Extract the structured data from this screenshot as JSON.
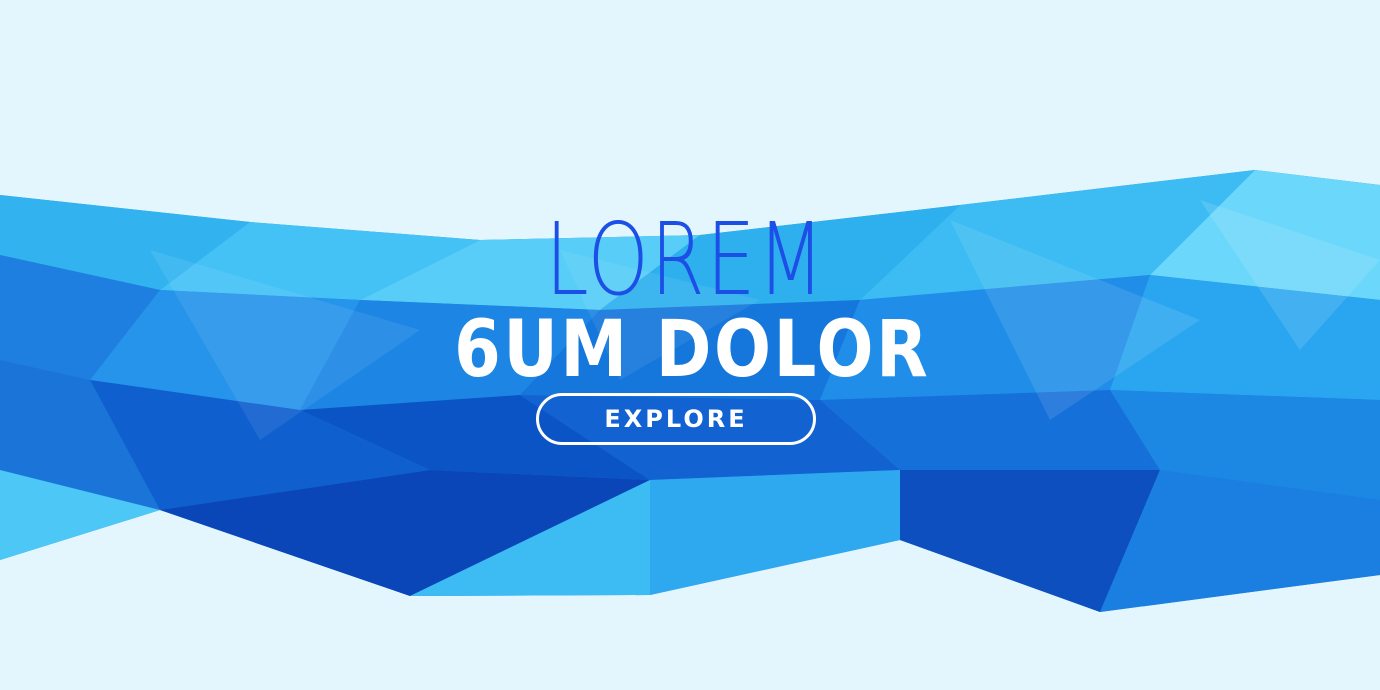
{
  "banner": {
    "headline_top": "LOREM",
    "headline_bottom": "6UM DOLOR",
    "button_label": "EXPLORE"
  },
  "colors": {
    "background": "#e4f6fd",
    "headline_top": "#1b4fe6",
    "headline_bottom": "#ffffff",
    "button_border": "#ffffff",
    "poly_dark": "#0a4fc4",
    "poly_mid": "#1a8be8",
    "poly_light": "#3fc3f5"
  }
}
